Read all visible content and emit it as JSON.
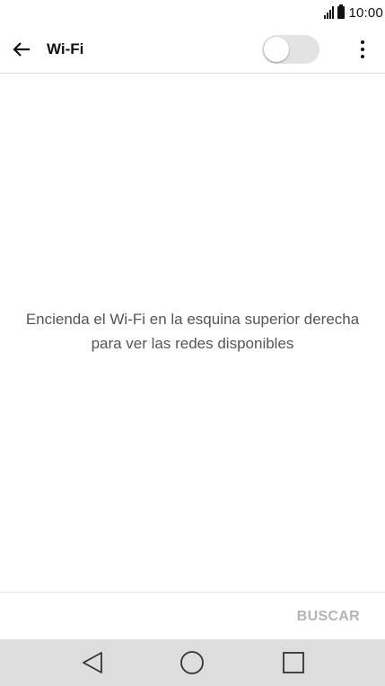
{
  "status_bar": {
    "time": "10:00",
    "icons": [
      "signal-icon",
      "battery-icon"
    ]
  },
  "app_bar": {
    "back_icon": "arrow-left-icon",
    "title": "Wi-Fi",
    "toggle_state": "off",
    "overflow_icon": "more-vert-icon"
  },
  "main": {
    "message": "Encienda el Wi-Fi en la esquina superior derecha para ver las redes disponibles"
  },
  "action_bar": {
    "scan_label": "BUSCAR"
  },
  "nav_bar": {
    "icons": [
      "nav-back-icon",
      "nav-home-icon",
      "nav-recent-icon"
    ]
  },
  "colors": {
    "toggle_track_off": "#e3e3e3",
    "disabled_text": "#b5b5b5",
    "nav_bar_bg": "#dddddd"
  }
}
